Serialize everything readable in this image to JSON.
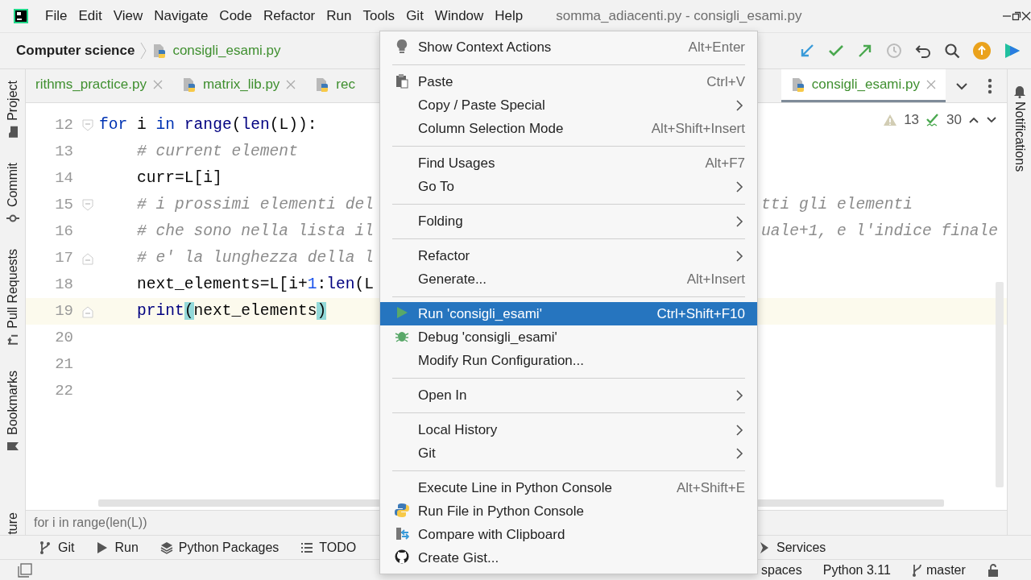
{
  "window": {
    "title": "somma_adiacenti.py - consigli_esami.py"
  },
  "menubar": [
    "File",
    "Edit",
    "View",
    "Navigate",
    "Code",
    "Refactor",
    "Run",
    "Tools",
    "Git",
    "Window",
    "Help"
  ],
  "navbar": {
    "project": "Computer science",
    "file": "consigli_esami.py"
  },
  "left_strip": [
    {
      "label": "Project"
    },
    {
      "label": "Commit"
    },
    {
      "label": "Pull Requests"
    },
    {
      "label": "Bookmarks"
    },
    {
      "label": "ture"
    }
  ],
  "right_strip": [
    {
      "label": "Notifications"
    }
  ],
  "tabs": [
    {
      "label": "rithms_practice.py",
      "selected": false,
      "closable": true
    },
    {
      "label": "matrix_lib.py",
      "selected": false,
      "closable": true
    },
    {
      "label": "rec",
      "selected": false,
      "closable": false
    },
    {
      "label": "consigli_esami.py",
      "selected": true,
      "closable": true
    }
  ],
  "inspections": {
    "warnings": "13",
    "typos": "30"
  },
  "code": [
    {
      "num": "12",
      "current": false,
      "indented": false,
      "fold_start": true,
      "fold_end": false,
      "tokens": [
        {
          "kind": "keyword",
          "text": "for"
        },
        {
          "kind": "plain",
          "text": " i "
        },
        {
          "kind": "keyword",
          "text": "in"
        },
        {
          "kind": "builtin",
          "text": " range"
        },
        {
          "kind": "plain",
          "text": "("
        },
        {
          "kind": "builtin",
          "text": "len"
        },
        {
          "kind": "plain",
          "text": "(L)):"
        }
      ]
    },
    {
      "num": "13",
      "current": false,
      "indented": true,
      "fold_start": false,
      "fold_end": false,
      "tokens": [
        {
          "kind": "comment",
          "text": "# current element"
        }
      ]
    },
    {
      "num": "14",
      "current": false,
      "indented": true,
      "fold_start": false,
      "fold_end": false,
      "tokens": [
        {
          "kind": "plain",
          "text": "curr=L[i]"
        }
      ]
    },
    {
      "num": "15",
      "current": false,
      "indented": true,
      "fold_start": true,
      "fold_end": false,
      "tokens": [
        {
          "kind": "comment",
          "text": "# i prossimi elementi del"
        }
      ],
      "tail": "tti gli elementi"
    },
    {
      "num": "16",
      "current": false,
      "indented": true,
      "fold_start": false,
      "fold_end": false,
      "tokens": [
        {
          "kind": "comment",
          "text": "# che sono nella lista il"
        }
      ],
      "tail": "uale+1, e l'indice finale"
    },
    {
      "num": "17",
      "current": false,
      "indented": true,
      "fold_start": false,
      "fold_end": true,
      "tokens": [
        {
          "kind": "comment",
          "text": "# e' la lunghezza della l"
        }
      ]
    },
    {
      "num": "18",
      "current": false,
      "indented": true,
      "fold_start": false,
      "fold_end": false,
      "tokens": [
        {
          "kind": "plain",
          "text": "next_elements=L[i+"
        },
        {
          "kind": "number",
          "text": "1"
        },
        {
          "kind": "plain",
          "text": ":"
        },
        {
          "kind": "builtin",
          "text": "len"
        },
        {
          "kind": "plain",
          "text": "(L"
        }
      ]
    },
    {
      "num": "19",
      "current": true,
      "indented": true,
      "fold_start": false,
      "fold_end": true,
      "tokens": [
        {
          "kind": "builtin",
          "text": "print"
        },
        {
          "kind": "brace",
          "text": "("
        },
        {
          "kind": "plain",
          "text": "next_elements"
        },
        {
          "kind": "brace",
          "text": ")"
        }
      ]
    },
    {
      "num": "20",
      "current": false,
      "fold_start": false,
      "fold_end": false
    },
    {
      "num": "21",
      "current": false,
      "fold_start": false,
      "fold_end": false
    },
    {
      "num": "22",
      "current": false,
      "fold_start": false,
      "fold_end": false
    }
  ],
  "breadcrumb": "for i in range(len(L))",
  "tool_windows": [
    {
      "label": "Git"
    },
    {
      "label": "Run"
    },
    {
      "label": "Python Packages"
    },
    {
      "label": "TODO"
    },
    {
      "label": "Services"
    }
  ],
  "status_bar": [
    "spaces",
    "Python 3.11",
    "master"
  ],
  "context_menu": [
    {
      "kind": "bulb",
      "label": "Show Context Actions",
      "shortcut": "Alt+Enter",
      "submenu": false,
      "selected": false
    },
    {
      "kind": "separator"
    },
    {
      "kind": "paste",
      "label": "Paste",
      "shortcut": "Ctrl+V",
      "submenu": false,
      "selected": false
    },
    {
      "kind": "plain",
      "label": "Copy / Paste Special",
      "submenu": true,
      "selected": false
    },
    {
      "kind": "plain",
      "label": "Column Selection Mode",
      "shortcut": "Alt+Shift+Insert",
      "submenu": false,
      "selected": false
    },
    {
      "kind": "separator"
    },
    {
      "kind": "plain",
      "label": "Find Usages",
      "shortcut": "Alt+F7",
      "submenu": false,
      "selected": false
    },
    {
      "kind": "plain",
      "label": "Go To",
      "submenu": true,
      "selected": false
    },
    {
      "kind": "separator"
    },
    {
      "kind": "plain",
      "label": "Folding",
      "submenu": true,
      "selected": false
    },
    {
      "kind": "separator"
    },
    {
      "kind": "plain",
      "label": "Refactor",
      "submenu": true,
      "selected": false
    },
    {
      "kind": "plain",
      "label": "Generate...",
      "shortcut": "Alt+Insert",
      "submenu": false,
      "selected": false
    },
    {
      "kind": "separator"
    },
    {
      "kind": "run",
      "label": "Run 'consigli_esami'",
      "shortcut": "Ctrl+Shift+F10",
      "submenu": false,
      "selected": true
    },
    {
      "kind": "debug",
      "label": "Debug 'consigli_esami'",
      "submenu": false,
      "selected": false
    },
    {
      "kind": "plain",
      "label": "Modify Run Configuration...",
      "submenu": false,
      "selected": false
    },
    {
      "kind": "separator"
    },
    {
      "kind": "plain",
      "label": "Open In",
      "submenu": true,
      "selected": false
    },
    {
      "kind": "separator"
    },
    {
      "kind": "plain",
      "label": "Local History",
      "submenu": true,
      "selected": false
    },
    {
      "kind": "plain",
      "label": "Git",
      "submenu": true,
      "selected": false
    },
    {
      "kind": "separator"
    },
    {
      "kind": "plain",
      "label": "Execute Line in Python Console",
      "shortcut": "Alt+Shift+E",
      "submenu": false,
      "selected": false
    },
    {
      "kind": "python",
      "label": "Run File in Python Console",
      "submenu": false,
      "selected": false
    },
    {
      "kind": "compare",
      "label": "Compare with Clipboard",
      "submenu": false,
      "selected": false
    },
    {
      "kind": "gist",
      "label": "Create Gist...",
      "submenu": false,
      "selected": false
    }
  ]
}
